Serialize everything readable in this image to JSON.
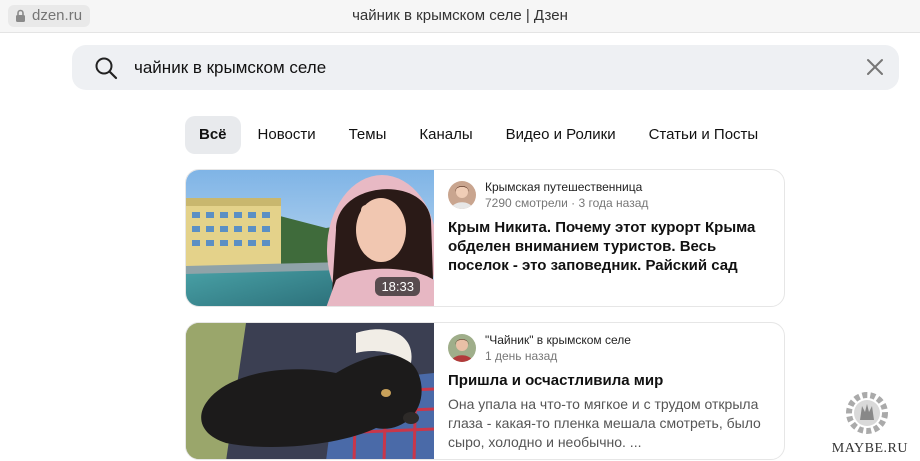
{
  "browser": {
    "url": "dzen.ru",
    "page_title": "чайник в крымском селе | Дзен"
  },
  "search": {
    "query": "чайник в крымском селе",
    "icon": "search-icon",
    "clear_icon": "close-icon"
  },
  "tabs": [
    {
      "label": "Всё",
      "active": true
    },
    {
      "label": "Новости",
      "active": false
    },
    {
      "label": "Темы",
      "active": false
    },
    {
      "label": "Каналы",
      "active": false
    },
    {
      "label": "Видео и Ролики",
      "active": false
    },
    {
      "label": "Статьи и Посты",
      "active": false
    }
  ],
  "results": [
    {
      "channel": "Крымская путешественница",
      "meta": "7290 смотрели · 3 года назад",
      "title": "Крым Никита. Почему этот курорт Крыма обделен вниманием туристов. Весь поселок - это заповедник. Райский сад",
      "duration": "18:33",
      "description": ""
    },
    {
      "channel": "\"Чайник\" в крымском селе",
      "meta": "1 день назад",
      "title": "Пришла и осчастливила мир",
      "duration": "",
      "description": "Она упала на что-то мягкое и с трудом открыла глаза - какая-то пленка мешала смотреть, было сыро, холодно и необычно. ..."
    }
  ],
  "watermark": {
    "text": "MAYBE.RU"
  }
}
